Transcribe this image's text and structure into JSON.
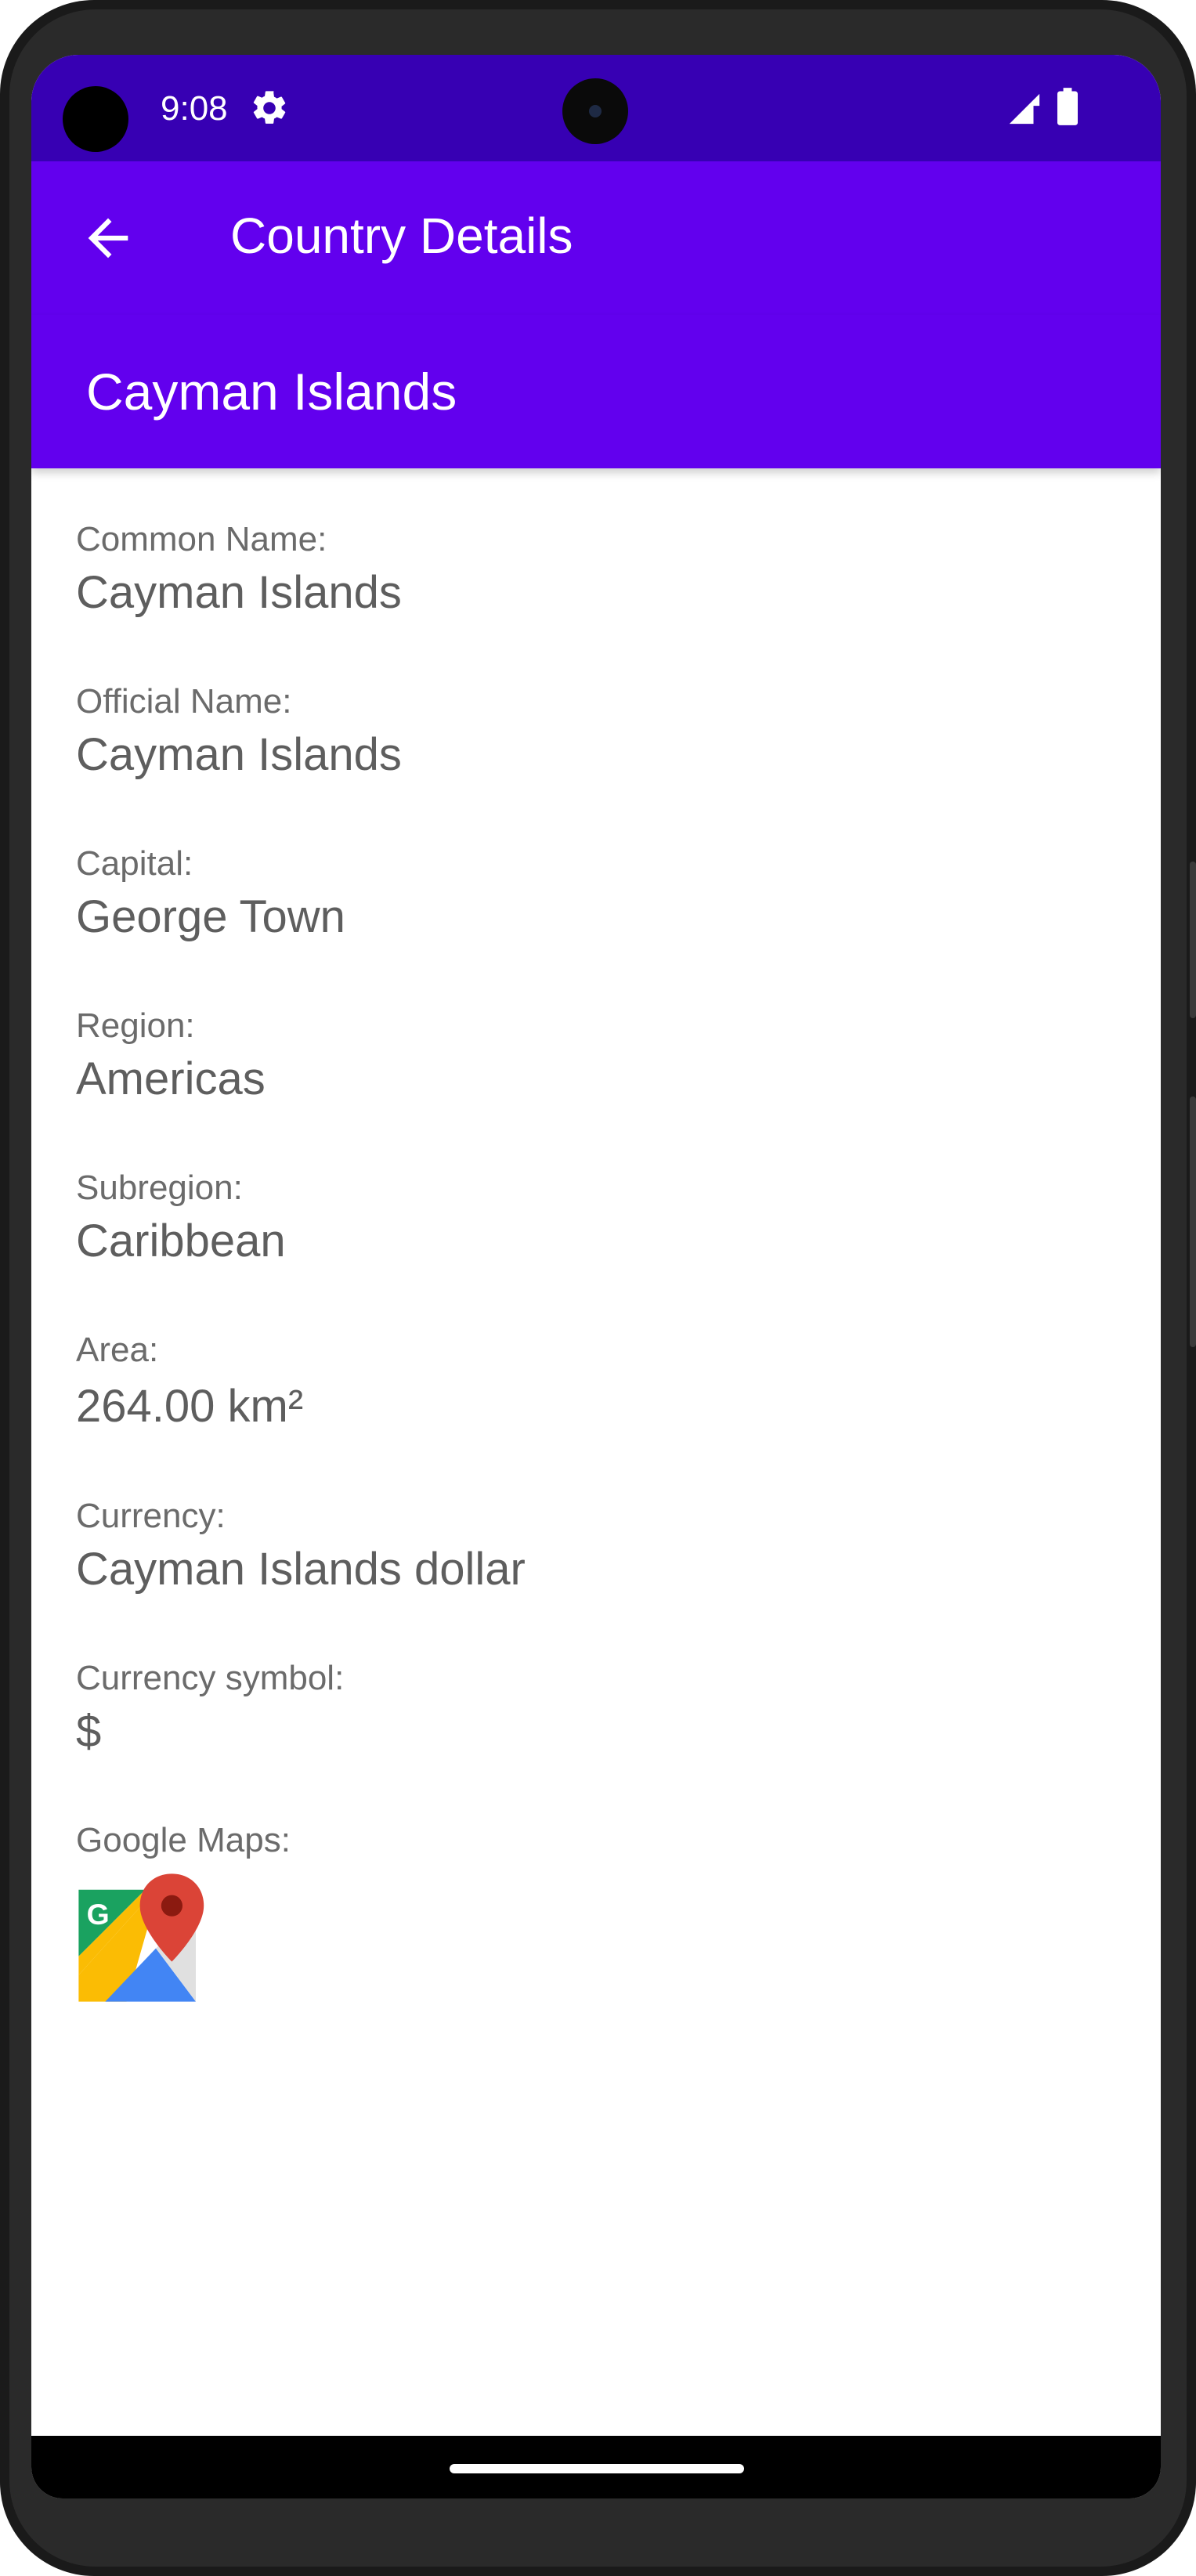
{
  "status_bar": {
    "time": "9:08",
    "icons": [
      "settings-gear-icon",
      "signal-icon",
      "battery-icon"
    ]
  },
  "app_bar": {
    "title": "Country Details",
    "back_icon": "arrow-back-icon"
  },
  "header": {
    "country_name": "Cayman Islands"
  },
  "details": [
    {
      "label": "Common Name:",
      "value": "Cayman Islands"
    },
    {
      "label": "Official Name:",
      "value": "Cayman Islands"
    },
    {
      "label": "Capital:",
      "value": "George Town"
    },
    {
      "label": "Region:",
      "value": "Americas"
    },
    {
      "label": "Subregion:",
      "value": "Caribbean"
    },
    {
      "label": "Area:",
      "value": "264.00 km²"
    },
    {
      "label": "Currency:",
      "value": "Cayman Islands dollar"
    },
    {
      "label": "Currency symbol:",
      "value": "$"
    }
  ],
  "maps": {
    "label": "Google Maps:",
    "icon": "google-maps-icon"
  },
  "colors": {
    "status_bar": "#3700b3",
    "primary": "#6200ee",
    "text_secondary": "#6b6b6b"
  }
}
